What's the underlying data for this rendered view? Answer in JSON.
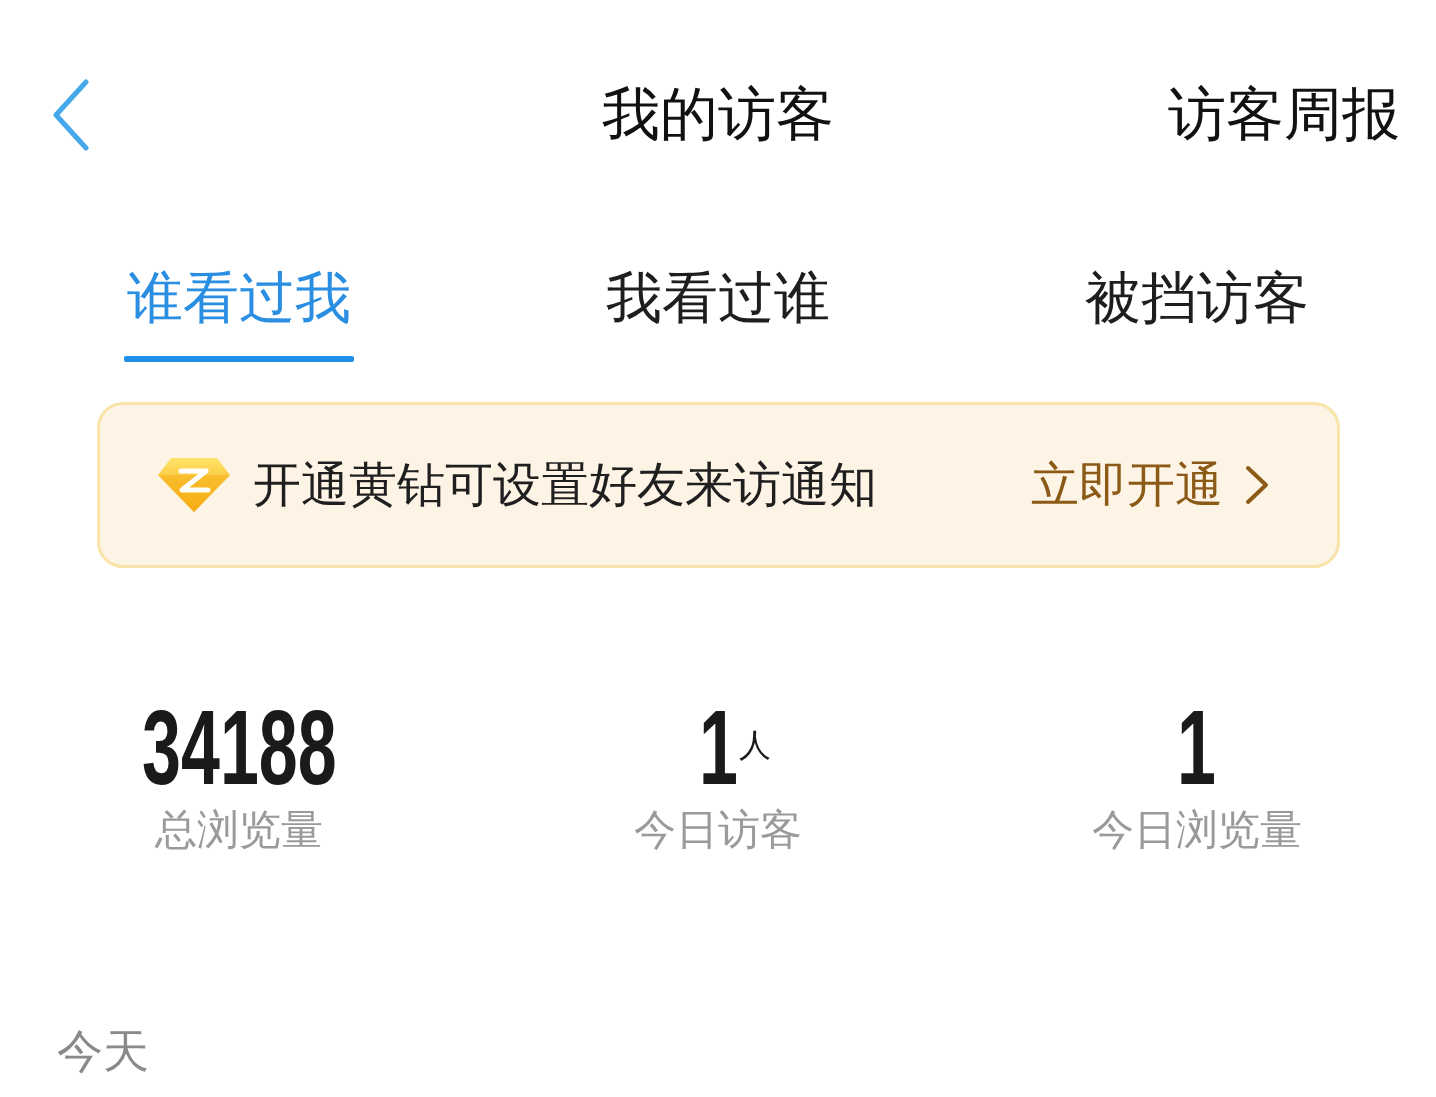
{
  "header": {
    "title": "我的访客",
    "action": "访客周报"
  },
  "tabs": [
    {
      "label": "谁看过我",
      "selected": true
    },
    {
      "label": "我看过谁",
      "selected": false
    },
    {
      "label": "被挡访客",
      "selected": false
    }
  ],
  "banner": {
    "message": "开通黄钻可设置好友来访通知",
    "action": "立即开通"
  },
  "stats": [
    {
      "value": "34188",
      "label": "总浏览量"
    },
    {
      "value": "1",
      "unit": "人",
      "label": "今日访客"
    },
    {
      "value": "1",
      "label": "今日浏览量"
    }
  ],
  "section": {
    "title": "今天"
  }
}
